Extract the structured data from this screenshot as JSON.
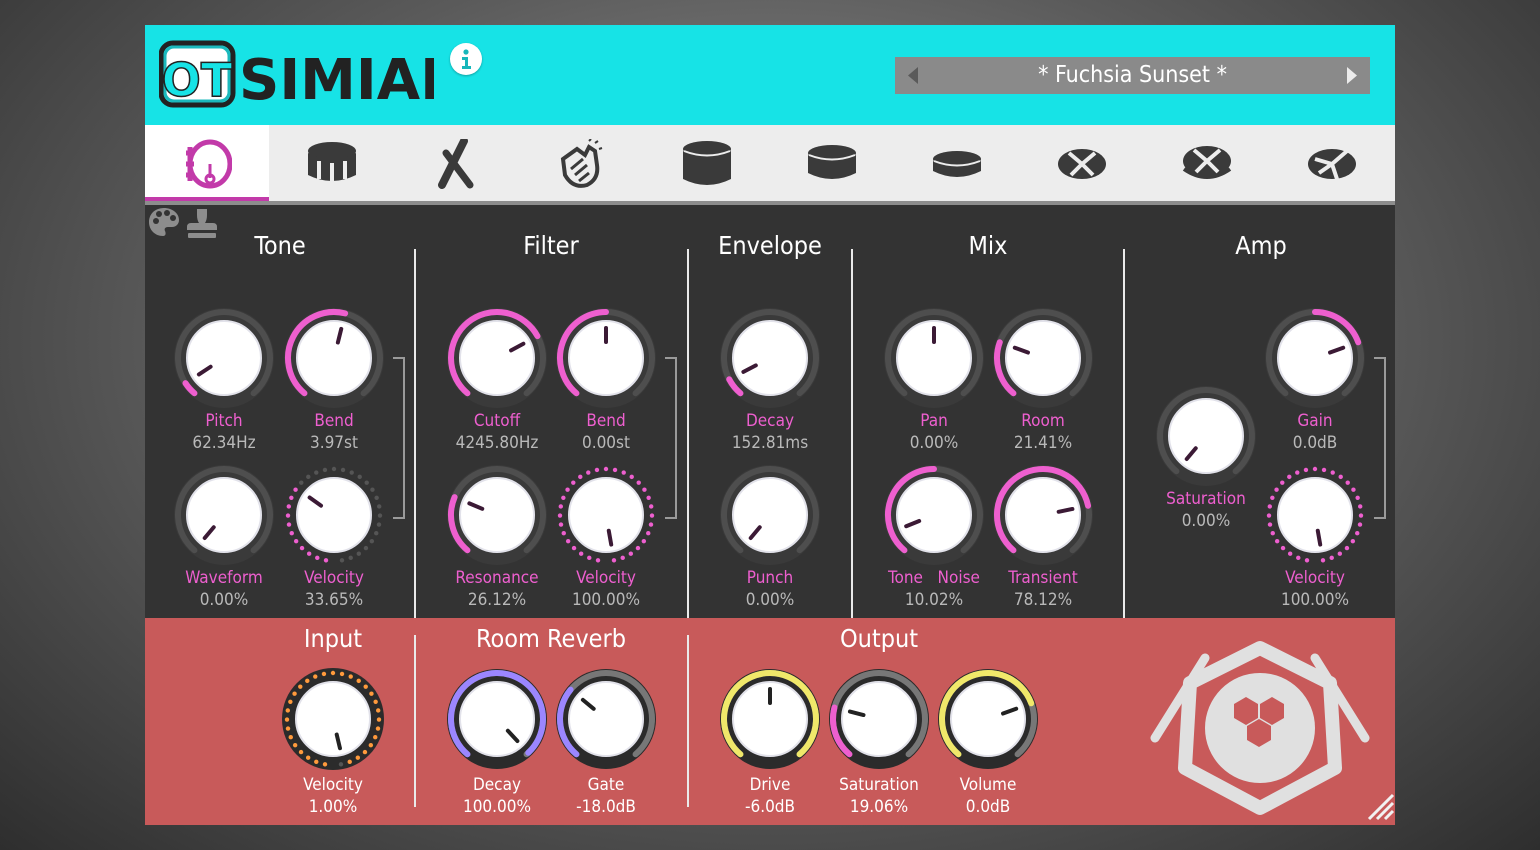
{
  "app": {
    "logo_text": "OT",
    "title": "SIMIAN",
    "preset": "* Fuchsia Sunset *"
  },
  "colors": {
    "accent": "#ee5fcf",
    "header": "#17e3e6",
    "panel": "#333333",
    "bottom": "#c85a5a"
  },
  "tabs": [
    {
      "icon": "kick-drum-icon",
      "active": true
    },
    {
      "icon": "snare-drum-icon",
      "active": false
    },
    {
      "icon": "drumsticks-icon",
      "active": false
    },
    {
      "icon": "clap-hands-icon",
      "active": false
    },
    {
      "icon": "tom-high-icon",
      "active": false
    },
    {
      "icon": "tom-mid-icon",
      "active": false
    },
    {
      "icon": "tom-low-icon",
      "active": false
    },
    {
      "icon": "hihat-closed-icon",
      "active": false
    },
    {
      "icon": "hihat-open-icon",
      "active": false
    },
    {
      "icon": "cymbal-icon",
      "active": false
    }
  ],
  "sections": {
    "tone": {
      "title": "Tone",
      "pitch": {
        "label": "Pitch",
        "value": "62.34Hz"
      },
      "bend": {
        "label": "Bend",
        "value": "3.97st"
      },
      "waveform": {
        "label": "Waveform",
        "value": "0.00%"
      },
      "velocity": {
        "label": "Velocity",
        "value": "33.65%"
      }
    },
    "filter": {
      "title": "Filter",
      "cutoff": {
        "label": "Cutoff",
        "value": "4245.80Hz"
      },
      "bend": {
        "label": "Bend",
        "value": "0.00st"
      },
      "resonance": {
        "label": "Resonance",
        "value": "26.12%"
      },
      "velocity": {
        "label": "Velocity",
        "value": "100.00%"
      }
    },
    "envelope": {
      "title": "Envelope",
      "decay": {
        "label": "Decay",
        "value": "152.81ms"
      },
      "punch": {
        "label": "Punch",
        "value": "0.00%"
      }
    },
    "mix": {
      "title": "Mix",
      "pan": {
        "label": "Pan",
        "value": "0.00%"
      },
      "room": {
        "label": "Room",
        "value": "21.41%"
      },
      "tone_noise": {
        "label_a": "Tone",
        "label_b": "Noise",
        "value": "10.02%"
      },
      "transient": {
        "label": "Transient",
        "value": "78.12%"
      }
    },
    "amp": {
      "title": "Amp",
      "saturation": {
        "label": "Saturation",
        "value": "0.00%"
      },
      "gain": {
        "label": "Gain",
        "value": "0.0dB"
      },
      "velocity": {
        "label": "Velocity",
        "value": "100.00%"
      }
    }
  },
  "bottom": {
    "input": {
      "title": "Input",
      "velocity": {
        "label": "Velocity",
        "value": "1.00%"
      }
    },
    "reverb": {
      "title": "Room Reverb",
      "decay": {
        "label": "Decay",
        "value": "100.00%"
      },
      "gate": {
        "label": "Gate",
        "value": "-18.0dB"
      }
    },
    "output": {
      "title": "Output",
      "drive": {
        "label": "Drive",
        "value": "-6.0dB"
      },
      "saturation": {
        "label": "Saturation",
        "value": "19.06%"
      },
      "volume": {
        "label": "Volume",
        "value": "0.0dB"
      }
    }
  },
  "knob_positions": {
    "tone_pitch": 0.06,
    "tone_bend": 0.55,
    "tone_waveform": 0.0,
    "tone_velocity": 0.34,
    "filter_cutoff": 0.72,
    "filter_bend": 0.5,
    "filter_resonance": 0.26,
    "filter_velocity": 1.0,
    "env_decay": 0.08,
    "env_punch": 0.0,
    "mix_pan": 0.5,
    "mix_room": 0.25,
    "mix_tone_noise": 0.1,
    "mix_transient": 0.78,
    "amp_saturation": 0.0,
    "amp_gain": 0.75,
    "amp_velocity": 1.0,
    "in_velocity": 0.99,
    "rv_decay": 0.99,
    "rv_gate": 0.32,
    "out_drive": 0.5,
    "out_saturation": 0.23,
    "out_volume": 0.75
  }
}
